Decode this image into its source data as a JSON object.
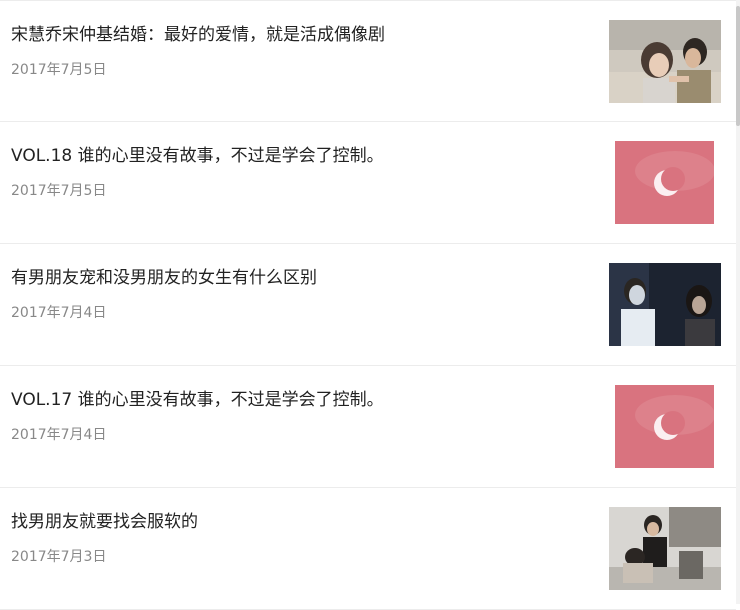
{
  "articles": [
    {
      "title": "宋慧乔宋仲基结婚：最好的爱情，就是活成偶像剧",
      "date": "2017年7月5日",
      "thumbnail": "couple-photo"
    },
    {
      "title": "VOL.18 谁的心里没有故事，不过是学会了控制。",
      "date": "2017年7月5日",
      "thumbnail": "pink-moon-image"
    },
    {
      "title": "有男朋友宠和没男朋友的女生有什么区别",
      "date": "2017年7月4日",
      "thumbnail": "night-couple-photo"
    },
    {
      "title": "VOL.17 谁的心里没有故事，不过是学会了控制。",
      "date": "2017年7月4日",
      "thumbnail": "pink-moon-image"
    },
    {
      "title": "找男朋友就要找会服软的",
      "date": "2017年7月3日",
      "thumbnail": "street-couple-photo"
    }
  ],
  "colors": {
    "title": "#222222",
    "date": "#888888",
    "divider": "#ececec",
    "moon_bg": "#d9737f"
  }
}
